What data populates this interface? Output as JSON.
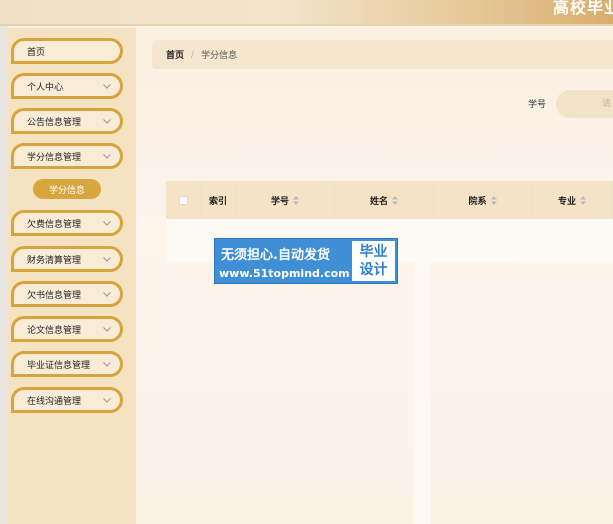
{
  "header": {
    "title": "高校毕业"
  },
  "sidebar": {
    "items": [
      {
        "label": "首页",
        "has_chevron": false
      },
      {
        "label": "个人中心",
        "has_chevron": true
      },
      {
        "label": "公告信息管理",
        "has_chevron": true
      },
      {
        "label": "学分信息管理",
        "has_chevron": true
      },
      {
        "label": "欠费信息管理",
        "has_chevron": true
      },
      {
        "label": "财务清算管理",
        "has_chevron": true
      },
      {
        "label": "欠书信息管理",
        "has_chevron": true
      },
      {
        "label": "论文信息管理",
        "has_chevron": true
      },
      {
        "label": "毕业证信息管理",
        "has_chevron": true
      },
      {
        "label": "在线沟通管理",
        "has_chevron": true
      }
    ],
    "active_sub_item": "学分信息"
  },
  "breadcrumb": {
    "home": "首页",
    "separator": "/",
    "current": "学分信息"
  },
  "search": {
    "label": "学号",
    "placeholder": "请"
  },
  "table": {
    "columns": [
      "索引",
      "学号",
      "姓名",
      "院系",
      "专业"
    ],
    "rows": []
  },
  "watermark": {
    "line1": "无须担心.自动发货",
    "line2": "www.51topmind.com",
    "box_top": "毕业",
    "box_bottom": "设计"
  },
  "colors": {
    "accent": "#d6a43f",
    "sidebar_bg": "#f5e2c0",
    "header_bg": "#f5e3c6",
    "watermark_blue": "#3f8fd6"
  }
}
